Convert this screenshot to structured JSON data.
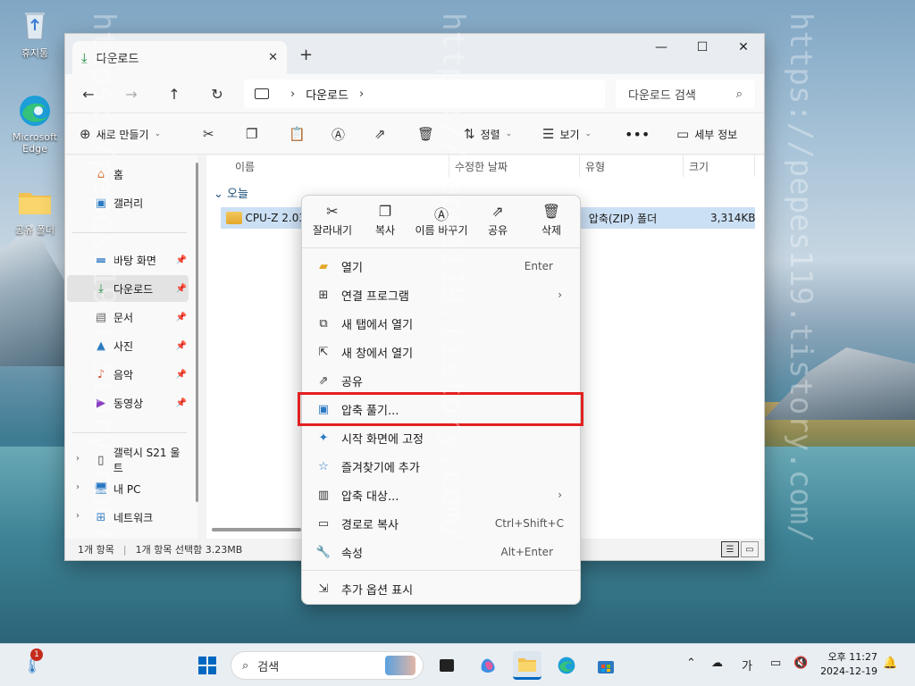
{
  "desktop": {
    "icons": [
      {
        "label": "휴지통",
        "icon": "recycle-bin-icon"
      },
      {
        "label": "Microsoft Edge",
        "icon": "edge-icon"
      },
      {
        "label": "공유 폴더",
        "icon": "folder-icon"
      }
    ],
    "watermark": "https://pepes119.tistory.com/"
  },
  "window": {
    "tab_title": "다운로드",
    "address": {
      "current": "다운로드"
    },
    "search_placeholder": "다운로드 검색",
    "toolbar": {
      "new_label": "새로 만들기",
      "sort_label": "정렬",
      "view_label": "보기",
      "details_label": "세부 정보"
    },
    "sidebar": {
      "items": [
        {
          "label": "홈"
        },
        {
          "label": "갤러리"
        },
        {
          "label": "바탕 화면"
        },
        {
          "label": "다운로드"
        },
        {
          "label": "문서"
        },
        {
          "label": "사진"
        },
        {
          "label": "음악"
        },
        {
          "label": "동영상"
        },
        {
          "label": "갤럭시 S21 울트"
        },
        {
          "label": "내 PC"
        },
        {
          "label": "네트워크"
        }
      ]
    },
    "columns": {
      "name": "이름",
      "modified": "수정한 날짜",
      "type": "유형",
      "size": "크기"
    },
    "group": "오늘",
    "file": {
      "name": "CPU-Z 2.03.",
      "type": "압축(ZIP) 폴더",
      "size": "3,314KB"
    },
    "status": {
      "count": "1개 항목",
      "selected": "1개 항목 선택함 3.23MB"
    }
  },
  "context_menu": {
    "quick_actions": [
      {
        "label": "잘라내기",
        "icon": "cut-icon"
      },
      {
        "label": "복사",
        "icon": "copy-icon"
      },
      {
        "label": "이름 바꾸기",
        "icon": "rename-icon"
      },
      {
        "label": "공유",
        "icon": "share-icon"
      },
      {
        "label": "삭제",
        "icon": "delete-icon"
      }
    ],
    "items": [
      {
        "label": "열기",
        "shortcut": "Enter"
      },
      {
        "label": "연결 프로그램"
      },
      {
        "label": "새 탭에서 열기"
      },
      {
        "label": "새 창에서 열기"
      },
      {
        "label": "공유"
      },
      {
        "label": "압축 풀기..."
      },
      {
        "label": "시작 화면에 고정"
      },
      {
        "label": "즐겨찾기에 추가"
      },
      {
        "label": "압축 대상..."
      },
      {
        "label": "경로로 복사",
        "shortcut": "Ctrl+Shift+C"
      },
      {
        "label": "속성",
        "shortcut": "Alt+Enter"
      },
      {
        "label": "추가 옵션 표시"
      }
    ]
  },
  "taskbar": {
    "notification_count": "1",
    "search_label": "검색",
    "clock": {
      "time": "오후 11:27",
      "date": "2024-12-19"
    }
  },
  "colors": {
    "accent": "#0067c0",
    "highlight": "#e32020",
    "selection": "#cce0f5"
  }
}
